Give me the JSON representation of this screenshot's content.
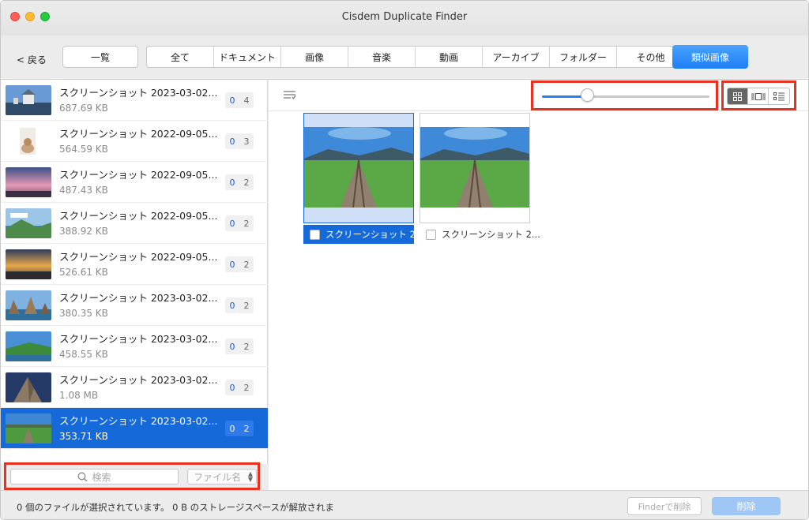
{
  "window": {
    "title": "Cisdem Duplicate Finder"
  },
  "toolbar": {
    "back_label": "< 戻る",
    "list_label": "一覧",
    "categories": [
      "全て",
      "ドキュメント",
      "画像",
      "音楽",
      "動画",
      "アーカイブ",
      "フォルダー",
      "その他"
    ],
    "similar_label": "類似画像"
  },
  "file_list": [
    {
      "name": "スクリーンショット 2023-03-02...",
      "size": "687.69 KB",
      "count_selected": "0",
      "count_total": "4",
      "thumb": "castle"
    },
    {
      "name": "スクリーンショット 2022-09-05...",
      "size": "564.59 KB",
      "count_selected": "0",
      "count_total": "3",
      "thumb": "cat"
    },
    {
      "name": "スクリーンショット 2022-09-05...",
      "size": "487.43 KB",
      "count_selected": "0",
      "count_total": "2",
      "thumb": "sunset-pink"
    },
    {
      "name": "スクリーンショット 2022-09-05...",
      "size": "388.92 KB",
      "count_selected": "0",
      "count_total": "2",
      "thumb": "coast"
    },
    {
      "name": "スクリーンショット 2022-09-05...",
      "size": "526.61 KB",
      "count_selected": "0",
      "count_total": "2",
      "thumb": "sunset-gold"
    },
    {
      "name": "スクリーンショット 2023-03-02...",
      "size": "380.35 KB",
      "count_selected": "0",
      "count_total": "2",
      "thumb": "rocks"
    },
    {
      "name": "スクリーンショット 2023-03-02...",
      "size": "458.55 KB",
      "count_selected": "0",
      "count_total": "2",
      "thumb": "green-cliff"
    },
    {
      "name": "スクリーンショット 2023-03-02...",
      "size": "1.08 MB",
      "count_selected": "0",
      "count_total": "2",
      "thumb": "mountain-rock"
    },
    {
      "name": "スクリーンショット 2023-03-02...",
      "size": "353.71 KB",
      "count_selected": "0",
      "count_total": "2",
      "thumb": "railway",
      "selected": true
    }
  ],
  "search": {
    "placeholder": "検索",
    "filter_value": "ファイル名"
  },
  "preview": {
    "slider_fraction": 0.27,
    "view_modes": [
      "grid-view-icon",
      "filmstrip-view-icon",
      "list-view-icon"
    ],
    "active_view": "grid-view-icon",
    "cards": [
      {
        "caption": "スクリーンショット 2...",
        "selected": true
      },
      {
        "caption": "スクリーンショット 2...",
        "selected": false
      }
    ]
  },
  "status": {
    "text": "0 個のファイルが選択されています。 0 B のストレージスペースが解放されま",
    "finder_delete_label": "Finderで削除",
    "delete_label": "削除"
  },
  "colors": {
    "accent": "#1569d8",
    "highlight": "#e8321f"
  }
}
